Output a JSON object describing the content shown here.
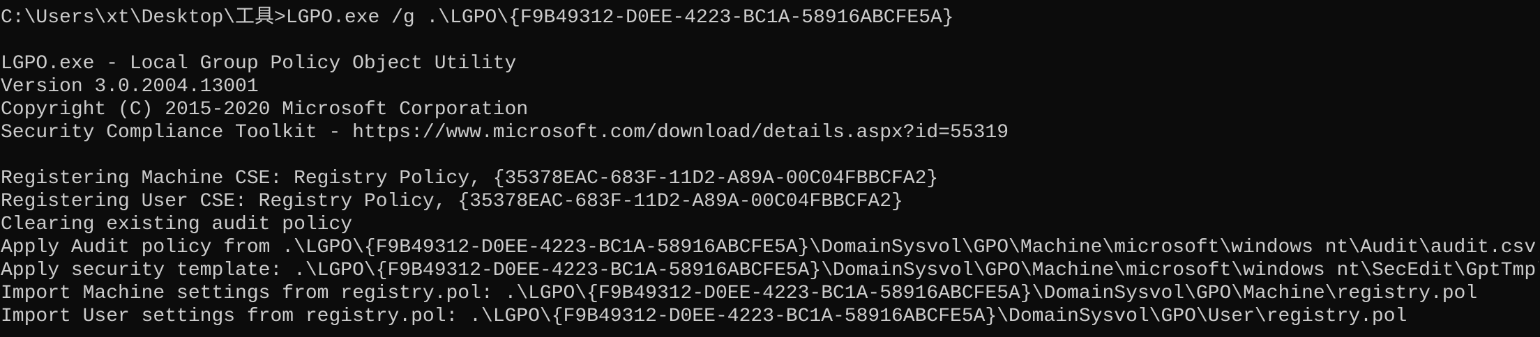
{
  "console": {
    "lines": [
      "C:\\Users\\xt\\Desktop\\工具>LGPO.exe /g .\\LGPO\\{F9B49312-D0EE-4223-BC1A-58916ABCFE5A}",
      "",
      "LGPO.exe - Local Group Policy Object Utility",
      "Version 3.0.2004.13001",
      "Copyright (C) 2015-2020 Microsoft Corporation",
      "Security Compliance Toolkit - https://www.microsoft.com/download/details.aspx?id=55319",
      "",
      "Registering Machine CSE: Registry Policy, {35378EAC-683F-11D2-A89A-00C04FBBCFA2}",
      "Registering User CSE: Registry Policy, {35378EAC-683F-11D2-A89A-00C04FBBCFA2}",
      "Clearing existing audit policy",
      "Apply Audit policy from .\\LGPO\\{F9B49312-D0EE-4223-BC1A-58916ABCFE5A}\\DomainSysvol\\GPO\\Machine\\microsoft\\windows nt\\Audit\\audit.csv",
      "Apply security template: .\\LGPO\\{F9B49312-D0EE-4223-BC1A-58916ABCFE5A}\\DomainSysvol\\GPO\\Machine\\microsoft\\windows nt\\SecEdit\\GptTmpl.inf",
      "Import Machine settings from registry.pol: .\\LGPO\\{F9B49312-D0EE-4223-BC1A-58916ABCFE5A}\\DomainSysvol\\GPO\\Machine\\registry.pol",
      "Import User settings from registry.pol: .\\LGPO\\{F9B49312-D0EE-4223-BC1A-58916ABCFE5A}\\DomainSysvol\\GPO\\User\\registry.pol"
    ]
  }
}
